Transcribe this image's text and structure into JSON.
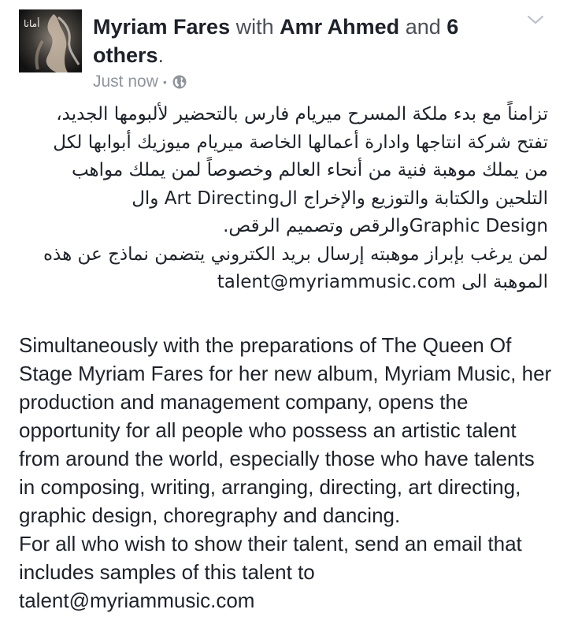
{
  "post": {
    "author": "Myriam Fares",
    "with_word": "with",
    "tagged": "Amr Ahmed",
    "and_word": "and",
    "others_count": "6",
    "others_word": "others",
    "end_punct": ".",
    "timestamp": "Just now",
    "separator": "•",
    "privacy_icon": "globe-icon",
    "menu_icon": "chevron-down-icon",
    "avatar_caption": "أمانا"
  },
  "body": {
    "arabic": [
      "تزامناً مع بدء ملكة المسرح ميريام فارس بالتحضير لألبومها الجديد،",
      "تفتح شركة انتاجها وادارة أعمالها الخاصة ميريام ميوزيك أبوابها لكل",
      "من يملك موهبة فنية من أنحاء العالم وخصوصاً لمن يملك مواهب",
      "التلحين والكتابة والتوزيع والإخراج الArt Directing وال",
      "Graphic Designوالرقص وتصميم الرقص.",
      "لمن يرغب بإبراز موهبته إرسال بريد الكتروني يتضمن نماذج عن هذه",
      "الموهبة الى talent@myriammusic.com"
    ],
    "english_paragraph": "Simultaneously with the preparations of The Queen Of Stage Myriam Fares for her new album, Myriam Music, her production and management company, opens the opportunity for all people who possess an artistic talent from around the world, especially those who have talents in composing, writing, arranging, directing, art directing, graphic design, choregraphy and dancing.",
    "english_paragraph_2": "For all who wish to show their talent, send an email that includes samples of this talent to talent@myriammusic.com"
  }
}
